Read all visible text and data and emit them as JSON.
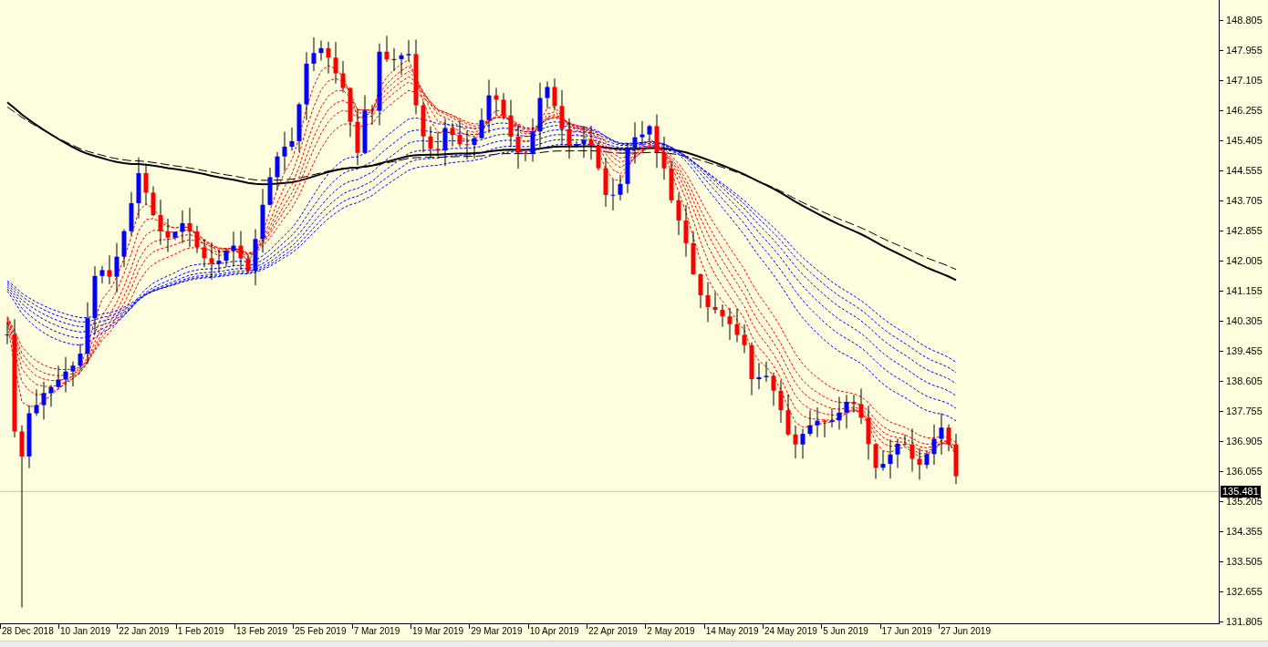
{
  "price_axis": {
    "labels": [
      "148.805",
      "147.955",
      "147.105",
      "146.255",
      "145.405",
      "144.555",
      "143.705",
      "142.855",
      "142.005",
      "141.155",
      "140.305",
      "139.455",
      "138.605",
      "137.755",
      "136.905",
      "136.055",
      "135.205",
      "134.355",
      "133.505",
      "132.655",
      "131.805"
    ]
  },
  "current_price": "135.481",
  "time_axis": {
    "labels": [
      "28 Dec 2018",
      "10 Jan 2019",
      "22 Jan 2019",
      "1 Feb 2019",
      "13 Feb 2019",
      "25 Feb 2019",
      "7 Mar 2019",
      "19 Mar 2019",
      "29 Mar 2019",
      "10 Apr 2019",
      "22 Apr 2019",
      "2 May 2019",
      "14 May 2019",
      "24 May 2019",
      "5 Jun 2019",
      "17 Jun 2019",
      "27 Jun 2019"
    ]
  }
}
